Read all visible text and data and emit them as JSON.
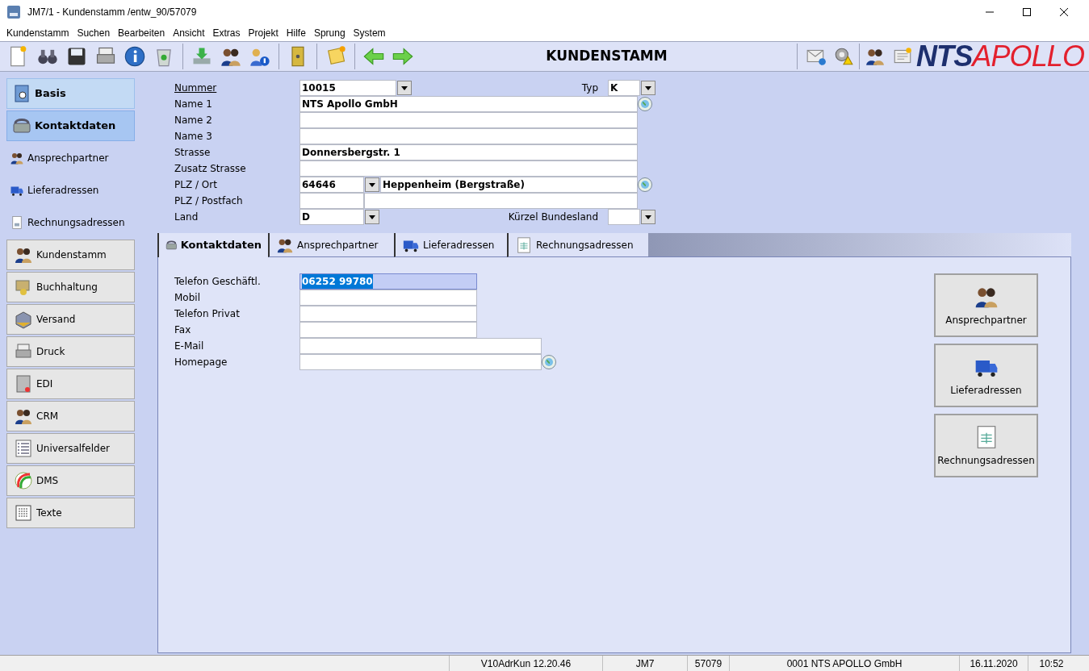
{
  "window": {
    "title": "JM7/1 - Kundenstamm /entw_90/57079"
  },
  "menu": [
    "Kundenstamm",
    "Suchen",
    "Bearbeiten",
    "Ansicht",
    "Extras",
    "Projekt",
    "Hilfe",
    "Sprung",
    "System"
  ],
  "toolbar": {
    "title": "KUNDENSTAMM",
    "logo_bold": "NTS",
    "logo_light": "APOLLO"
  },
  "sidebar": {
    "nav": [
      {
        "label": "Basis",
        "selected": false
      },
      {
        "label": "Kontaktdaten",
        "selected": true
      }
    ],
    "links": [
      "Ansprechpartner",
      "Lieferadressen",
      "Rechnungsadressen"
    ],
    "modules": [
      "Kundenstamm",
      "Buchhaltung",
      "Versand",
      "Druck",
      "EDI",
      "CRM",
      "Universalfelder",
      "DMS",
      "Texte"
    ]
  },
  "header_form": [
    {
      "label": "Nummer",
      "kind": "link",
      "values": [
        "10015"
      ],
      "right_label": "Typ",
      "right_value": "K"
    },
    {
      "label": "Name 1",
      "kind": "plain",
      "values": [
        "NTS Apollo GmbH"
      ]
    },
    {
      "label": "Name 2",
      "kind": "plain"
    },
    {
      "label": "Name 3",
      "kind": "plain"
    },
    {
      "label": "Strasse",
      "kind": "plain",
      "values": [
        "Donnersbergstr. 1"
      ]
    },
    {
      "label": "Zusatz Strasse",
      "kind": "plain"
    },
    {
      "label": "PLZ / Ort",
      "kind": "plain",
      "values": [
        "64646",
        "Heppenheim (Bergstraße)"
      ]
    },
    {
      "label": "PLZ / Postfach",
      "kind": "plain"
    },
    {
      "label": "Land",
      "kind": "plain",
      "values": [
        "D"
      ],
      "right_label": "Kürzel Bundesland"
    }
  ],
  "tabs": [
    {
      "label": "Kontaktdaten",
      "selected": true
    },
    {
      "label": "Ansprechpartner",
      "selected": false
    },
    {
      "label": "Lieferadressen",
      "selected": false
    },
    {
      "label": "Rechnungsadressen",
      "selected": false
    }
  ],
  "contact_fields": [
    {
      "label": "Telefon Geschäftl.",
      "value": "06252 99780",
      "focused": true
    },
    {
      "label": "Mobil",
      "focused": false
    },
    {
      "label": "Telefon Privat",
      "focused": false
    },
    {
      "label": "Fax",
      "focused": false
    },
    {
      "label": "E-Mail",
      "focused": false
    },
    {
      "label": "Homepage",
      "focused": false
    }
  ],
  "side_buttons": [
    "Ansprechpartner",
    "Lieferadressen",
    "Rechnungsadressen"
  ],
  "status_bar": [
    "V10AdrKun 12.20.46",
    "JM7",
    "57079",
    "0001 NTS APOLLO GmbH",
    "16.11.2020",
    "10:52"
  ]
}
